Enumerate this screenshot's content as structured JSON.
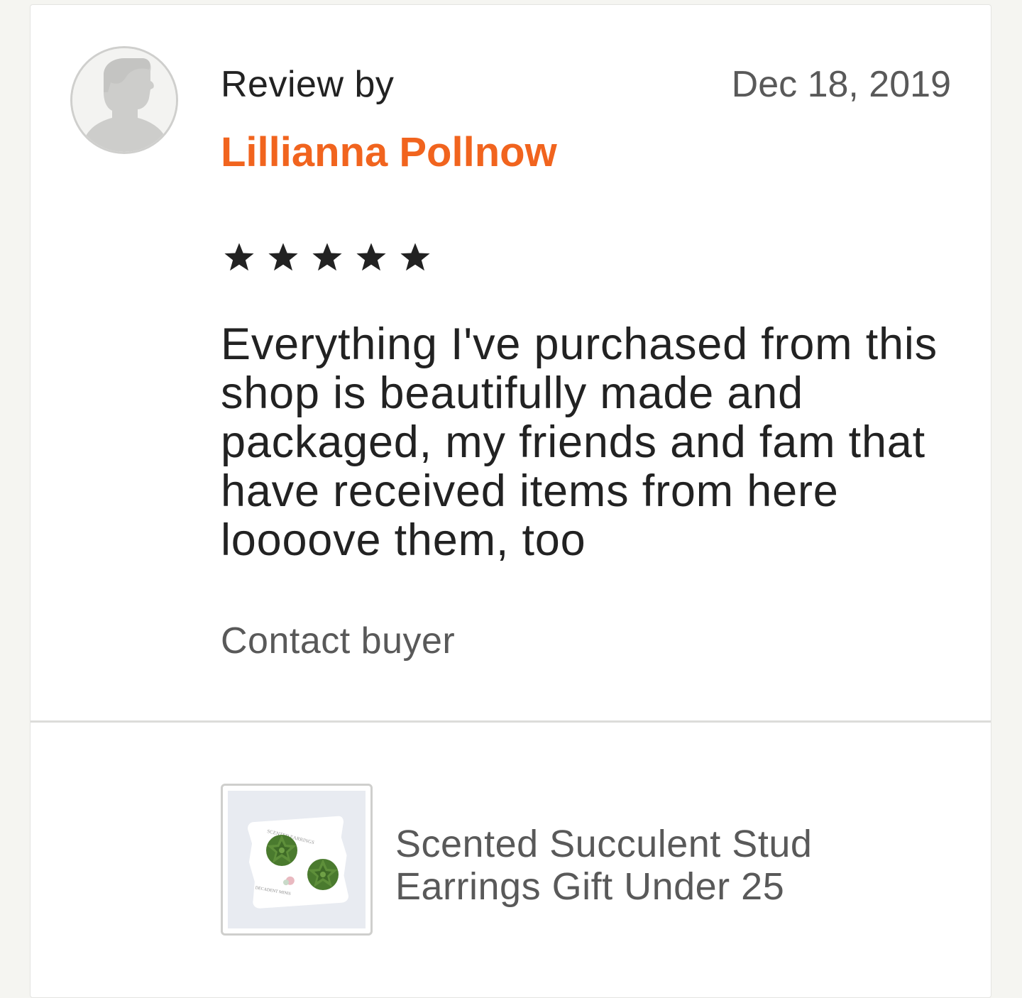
{
  "review": {
    "review_by_label": "Review by",
    "date": "Dec 18, 2019",
    "reviewer_name": "Lillianna Pollnow",
    "rating": 5,
    "rating_max": 5,
    "text": "Everything I've purchased from this shop is beautifully made and packaged, my friends and fam that have received items from here loooove them, too",
    "contact_label": "Contact buyer"
  },
  "product": {
    "title": "Scented Succulent Stud Earrings Gift Under 25",
    "thumbnail": {
      "card_line_1": "SCENTED EARRINGS",
      "card_line_2": "DECADENT MINIS"
    }
  },
  "colors": {
    "accent": "#f1641e",
    "text": "#222222",
    "muted": "#595959",
    "background": "#f5f5f1"
  },
  "icons": {
    "avatar": "default-user-silhouette-icon",
    "star": "star-icon"
  }
}
